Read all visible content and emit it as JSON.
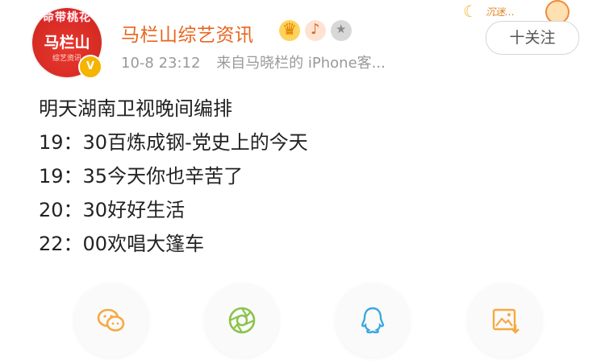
{
  "header": {
    "avatar": {
      "top_text": "命带桃花",
      "main_text": "马栏山",
      "sub_text": "综艺资讯"
    },
    "account_name": "马栏山综艺资讯",
    "timestamp": "10-8 23:12",
    "source": "来自马晓栏的 iPhone客...",
    "follow_button": "十关注",
    "decor_text": "沉迷…"
  },
  "post": {
    "lines": [
      "明天湖南卫视晚间编排",
      "19：30百炼成钢-党史上的今天",
      "19：35今天你也辛苦了",
      "20：30好好生活",
      "22：00欢唱大篷车"
    ]
  },
  "share": {
    "icons": [
      "wechat-icon",
      "moments-icon",
      "qq-icon",
      "save-image-icon"
    ],
    "colors": {
      "accent": "#f6a940",
      "wechat": "#6ab944",
      "moments": "#8bc34a",
      "qq": "#3aa8e0"
    }
  },
  "colors": {
    "name": "#e9651f",
    "meta": "#9a9a9a",
    "text": "#222222"
  }
}
